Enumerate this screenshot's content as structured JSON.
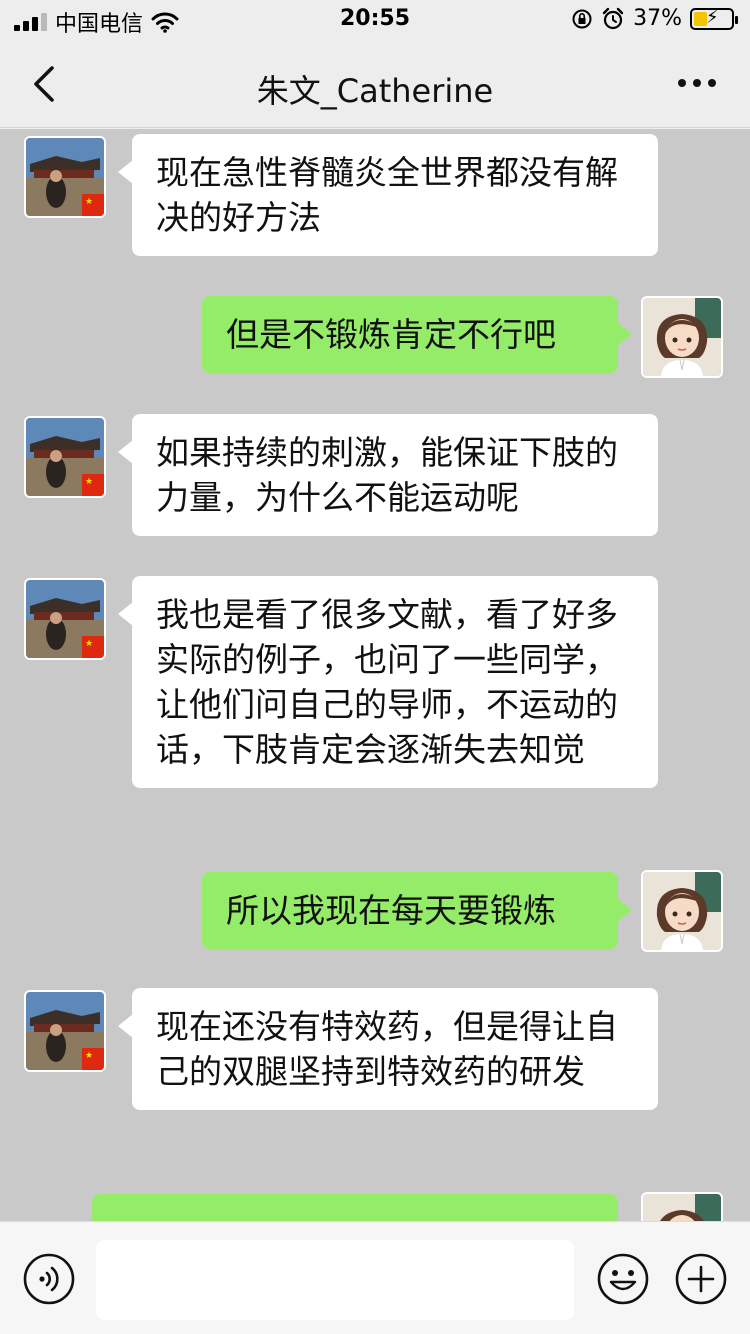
{
  "status": {
    "carrier": "中国电信",
    "time": "20:55",
    "battery": "37%",
    "battery_level": 0.37
  },
  "nav": {
    "title": "朱文_Catherine"
  },
  "messages": [
    {
      "side": "in",
      "text": "现在急性脊髓炎全世界都没有解决的好方法"
    },
    {
      "side": "out",
      "text": "但是不锻炼肯定不行吧"
    },
    {
      "side": "in",
      "text": "如果持续的刺激，能保证下肢的力量，为什么不能运动呢"
    },
    {
      "side": "in",
      "text": "我也是看了很多文献，看了好多实际的例子，也问了一些同学，让他们问自己的导师，不运动的话，下肢肯定会逐渐失去知觉"
    },
    {
      "side": "out",
      "text": "所以我现在每天要锻炼"
    },
    {
      "side": "in",
      "text": "现在还没有特效药，但是得让自己的双腿坚持到特效药的研发"
    }
  ],
  "input": {
    "value": ""
  },
  "icons": {
    "back": "chevron-left-icon",
    "more": "more-icon",
    "voice": "voice-icon",
    "emoji": "emoji-icon",
    "plus": "plus-icon",
    "wifi": "wifi-icon",
    "signal": "signal-icon",
    "alarm": "alarm-icon",
    "lock_rotation": "rotation-lock-icon",
    "china_flag": "china-flag-icon"
  },
  "colors": {
    "outgoing_bubble": "#95ec69",
    "incoming_bubble": "#ffffff",
    "chat_background": "#c9c9c9"
  }
}
